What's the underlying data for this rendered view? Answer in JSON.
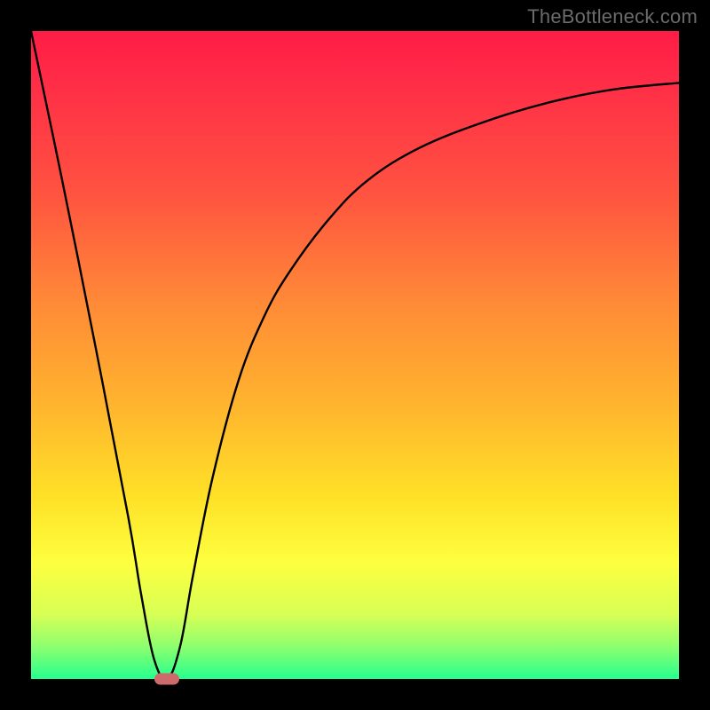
{
  "watermark": "TheBottleneck.com",
  "chart_data": {
    "type": "line",
    "title": "",
    "xlabel": "",
    "ylabel": "",
    "xlim": [
      0,
      100
    ],
    "ylim": [
      0,
      100
    ],
    "grid": false,
    "legend": false,
    "series": [
      {
        "name": "bottleneck-curve",
        "x": [
          0,
          5,
          10,
          15,
          17,
          19,
          21,
          23,
          25,
          28,
          32,
          36,
          40,
          46,
          52,
          60,
          70,
          80,
          90,
          100
        ],
        "y": [
          100,
          76,
          51,
          25,
          13,
          3,
          0,
          5,
          16,
          31,
          46,
          56,
          63,
          71,
          77,
          82,
          86,
          89,
          91,
          92
        ]
      }
    ],
    "marker": {
      "x_pct": 21,
      "y_pct": 0
    },
    "background_gradient": {
      "top": "#ff1c46",
      "mid1": "#ff8a37",
      "mid2": "#ffe127",
      "bottom": "#26ff8e"
    }
  }
}
